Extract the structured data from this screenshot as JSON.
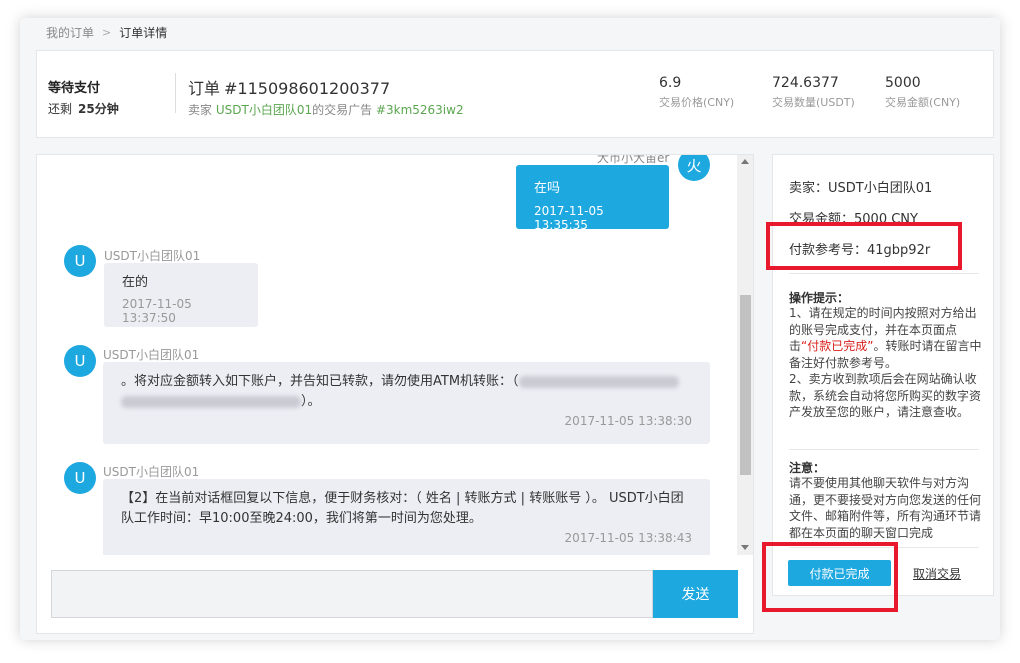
{
  "breadcrumb": {
    "parent": "我的订单",
    "separator": ">",
    "current": "订单详情"
  },
  "header": {
    "status_title": "等待支付",
    "remain_label": "还剩",
    "remain_value": "25分钟",
    "order_label": "订单",
    "order_no": "#115098601200377",
    "seller_prefix": "卖家",
    "seller_name": "USDT小白团队01",
    "ad_text": "的交易广告",
    "ad_id": "#3km5263iw2",
    "stats": [
      {
        "value": "6.9",
        "label": "交易价格(CNY)"
      },
      {
        "value": "724.6377",
        "label": "交易数量(USDT)"
      },
      {
        "value": "5000",
        "label": "交易金额(CNY)"
      }
    ]
  },
  "chat": {
    "self_name": "大币小大宙er",
    "self_avatar": "火",
    "self_message": {
      "text": "在吗",
      "time": "2017-11-05 13:35:35"
    },
    "messages": [
      {
        "avatar": "U",
        "sender": "USDT小白团队01",
        "text": "在的",
        "time": "2017-11-05 13:37:50"
      },
      {
        "avatar": "U",
        "sender": "USDT小白团队01",
        "text_a": "。将对应金额转入如下账户，并告知已转款，请勿使用ATM机转账：（",
        "text_b": "）。",
        "time": "2017-11-05 13:38:30"
      },
      {
        "avatar": "U",
        "sender": "USDT小白团队01",
        "text": "【2】在当前对话框回复以下信息，便于财务核对：（ 姓名 | 转账方式 | 转账账号 ）。 USDT小白团队工作时间：早10:00至晚24:00，我们将第一时间为您处理。",
        "time": "2017-11-05 13:38:43"
      }
    ],
    "input_placeholder": "",
    "send_label": "发送"
  },
  "side": {
    "seller_line": "卖家：USDT小白团队01",
    "amount_line": "交易金额：5000 CNY",
    "ref_line": "付款参考号：41gbp92r",
    "tips_title": "操作提示：",
    "tip1_a": "1、请在规定的时间内按照对方给出的账号完成支付，并在本页面点击",
    "tip1_red": "“付款已完成”",
    "tip1_b": "。转账时请在留言中备注好付款参考号。",
    "tip2": "2、卖方收到款项后会在网站确认收款，系统会自动将您所购买的数字资产发放至您的账户，请注意查收。",
    "notice_title": "注意：",
    "notice": "请不要使用其他聊天软件与对方沟通，更不要接受对方向您发送的任何文件、邮箱附件等，所有沟通环节请都在本页面的聊天窗口完成",
    "pay_button": "付款已完成",
    "cancel_link": "取消交易"
  },
  "colors": {
    "accent": "#1ea8e0",
    "highlight_box": "#e8192c",
    "green": "#5aa74f",
    "warning": "#d9201c"
  }
}
